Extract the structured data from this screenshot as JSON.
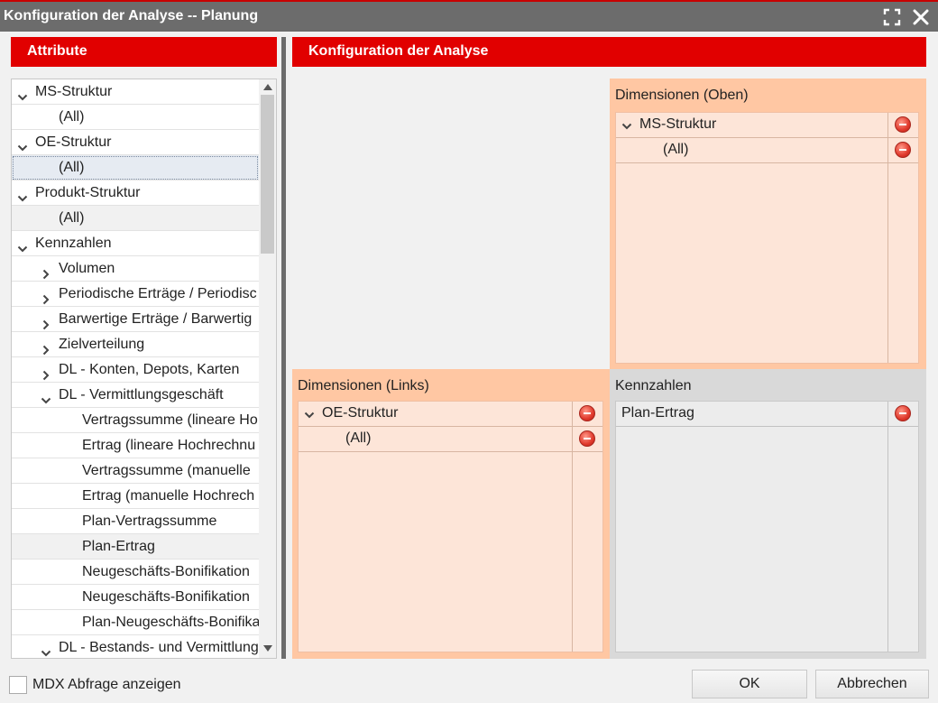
{
  "window": {
    "title": "Konfiguration der Analyse -- Planung",
    "maximize_icon": "maximize-icon",
    "close_icon": "close-icon"
  },
  "left_panel": {
    "header": "Attribute",
    "tree": [
      {
        "label": "MS-Struktur",
        "level": 0,
        "expander": "expanded",
        "style": "normal"
      },
      {
        "label": "(All)",
        "level": 1,
        "expander": "none",
        "style": "normal"
      },
      {
        "label": "OE-Struktur",
        "level": 0,
        "expander": "expanded",
        "style": "normal"
      },
      {
        "label": "(All)",
        "level": 1,
        "expander": "none",
        "style": "selected"
      },
      {
        "label": "Produkt-Struktur",
        "level": 0,
        "expander": "expanded",
        "style": "normal"
      },
      {
        "label": "(All)",
        "level": 1,
        "expander": "none",
        "style": "alt"
      },
      {
        "label": "Kennzahlen",
        "level": 0,
        "expander": "expanded",
        "style": "normal"
      },
      {
        "label": "Volumen",
        "level": 1,
        "expander": "collapsed",
        "style": "normal"
      },
      {
        "label": "Periodische Erträge / Periodisc",
        "level": 1,
        "expander": "collapsed",
        "style": "normal"
      },
      {
        "label": "Barwertige Erträge / Barwertig",
        "level": 1,
        "expander": "collapsed",
        "style": "normal"
      },
      {
        "label": "Zielverteilung",
        "level": 1,
        "expander": "collapsed",
        "style": "normal"
      },
      {
        "label": "DL - Konten, Depots, Karten",
        "level": 1,
        "expander": "collapsed",
        "style": "normal"
      },
      {
        "label": "DL - Vermittlungsgeschäft",
        "level": 1,
        "expander": "expanded",
        "style": "normal"
      },
      {
        "label": "Vertragssumme (lineare Ho",
        "level": 2,
        "expander": "none",
        "style": "normal"
      },
      {
        "label": "Ertrag (lineare Hochrechnu",
        "level": 2,
        "expander": "none",
        "style": "normal"
      },
      {
        "label": "Vertragssumme (manuelle",
        "level": 2,
        "expander": "none",
        "style": "normal"
      },
      {
        "label": "Ertrag (manuelle Hochrech",
        "level": 2,
        "expander": "none",
        "style": "normal"
      },
      {
        "label": "Plan-Vertragssumme",
        "level": 2,
        "expander": "none",
        "style": "normal"
      },
      {
        "label": "Plan-Ertrag",
        "level": 2,
        "expander": "none",
        "style": "alt"
      },
      {
        "label": "Neugeschäfts-Bonifikation",
        "level": 2,
        "expander": "none",
        "style": "normal"
      },
      {
        "label": "Neugeschäfts-Bonifikation",
        "level": 2,
        "expander": "none",
        "style": "normal"
      },
      {
        "label": "Plan-Neugeschäfts-Bonifika",
        "level": 2,
        "expander": "none",
        "style": "normal"
      },
      {
        "label": "DL - Bestands- und Vermittlung",
        "level": 1,
        "expander": "expanded",
        "style": "normal"
      }
    ]
  },
  "right_panel": {
    "header": "Konfiguration der Analyse",
    "dim_top": {
      "title": "Dimensionen (Oben)",
      "rows": [
        {
          "label": "MS-Struktur",
          "expander": "expanded"
        },
        {
          "label": "(All)",
          "expander": "none"
        }
      ]
    },
    "dim_left": {
      "title": "Dimensionen (Links)",
      "rows": [
        {
          "label": "OE-Struktur",
          "expander": "expanded"
        },
        {
          "label": "(All)",
          "expander": "none"
        }
      ]
    },
    "measures": {
      "title": "Kennzahlen",
      "rows": [
        {
          "label": "Plan-Ertrag",
          "expander": "none"
        }
      ]
    },
    "remove_icon": "remove-circle-icon"
  },
  "footer": {
    "mdx_checkbox_label": "MDX Abfrage anzeigen",
    "mdx_checked": false,
    "ok_label": "OK",
    "cancel_label": "Abbrechen"
  }
}
